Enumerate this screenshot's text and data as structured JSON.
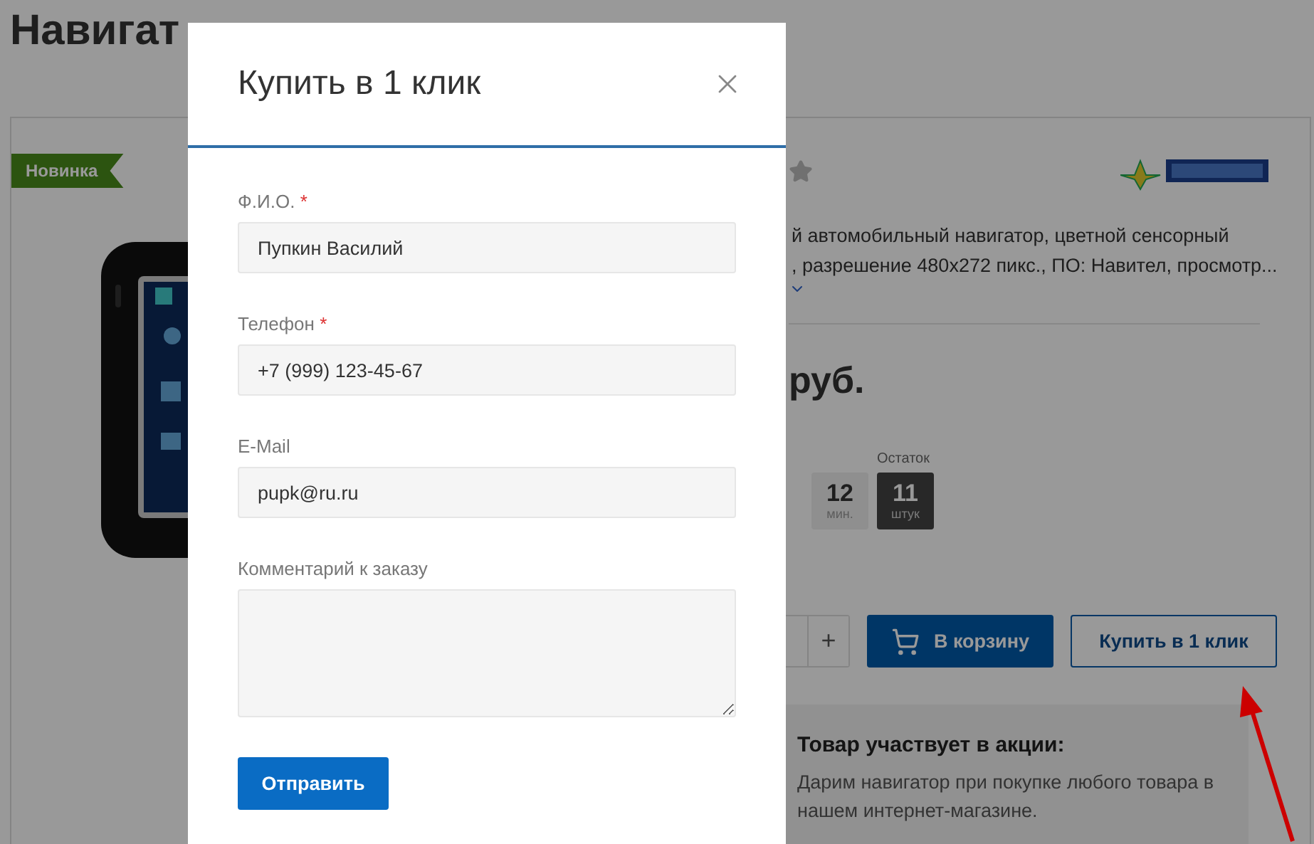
{
  "page": {
    "title": "Навигат",
    "badge": "Новинка",
    "description": [
      "й автомобильный навигатор, цветной сенсорный",
      ", разрешение 480x272 пикс., ПО: Навител, просмотр..."
    ],
    "price": "руб.",
    "counters": [
      {
        "kind": "time",
        "value": "12",
        "unit": "мин."
      },
      {
        "kind": "stock",
        "label": "Остаток",
        "value": "11",
        "unit": "штук"
      }
    ],
    "stepper": {
      "plus": "+"
    },
    "cart_button": "В корзину",
    "one_click_button": "Купить в 1 клик",
    "promo": {
      "title": "Товар участвует в акции:",
      "text": "Дарим навигатор при покупке любого товара в нашем интернет-магазине."
    }
  },
  "modal": {
    "title": "Купить в 1 клик",
    "fields": [
      {
        "kind": "input",
        "label": "Ф.И.О.",
        "required_mark": "*",
        "value": "Пупкин Василий"
      },
      {
        "kind": "input",
        "label": "Телефон",
        "required_mark": "*",
        "value": "+7 (999) 123-45-67"
      },
      {
        "kind": "input",
        "label": "E-Mail",
        "value": "pupk@ru.ru"
      },
      {
        "kind": "textarea",
        "label": "Комментарий к заказу"
      }
    ],
    "submit": "Отправить"
  }
}
